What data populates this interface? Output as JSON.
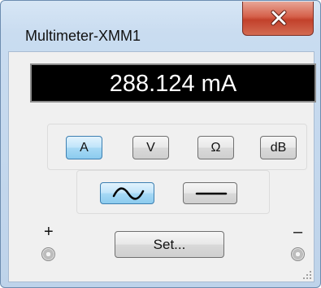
{
  "window": {
    "title": "Multimeter-XMM1",
    "close_label": "Close"
  },
  "display": {
    "reading": "288.124 mA"
  },
  "modes": {
    "items": [
      {
        "label": "A",
        "active": true
      },
      {
        "label": "V",
        "active": false
      },
      {
        "label": "Ω",
        "active": false
      },
      {
        "label": "dB",
        "active": false
      }
    ]
  },
  "waveforms": {
    "items": [
      {
        "icon": "ac-sine-wave-icon",
        "active": true
      },
      {
        "icon": "dc-flat-line-icon",
        "active": false
      }
    ]
  },
  "settings": {
    "set_label": "Set..."
  },
  "terminals": {
    "positive_label": "+",
    "negative_label": "–"
  },
  "colors": {
    "active_accent": "#8ccbee",
    "close_red": "#c2412b",
    "display_bg": "#000000",
    "display_text": "#ffffff"
  }
}
